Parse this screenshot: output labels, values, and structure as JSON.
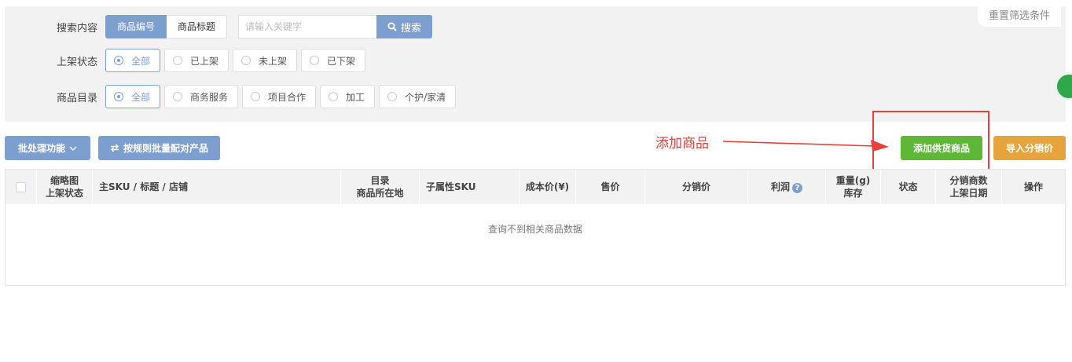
{
  "filters": {
    "reset_label": "重置筛选条件",
    "search": {
      "label": "搜索内容",
      "type_options": [
        "商品编号",
        "商品标题"
      ],
      "selected_type": "商品编号",
      "placeholder": "请输入关键字",
      "value": "",
      "button_label": "搜索"
    },
    "shelf_status": {
      "label": "上架状态",
      "options": [
        "全部",
        "已上架",
        "未上架",
        "已下架"
      ],
      "selected": "全部"
    },
    "catalog": {
      "label": "商品目录",
      "options": [
        "全部",
        "商务服务",
        "项目合作",
        "加工",
        "个护/家清"
      ],
      "selected": "全部"
    }
  },
  "toolbar": {
    "batch_label": "批处理功能",
    "match_label": "按规则批量配对产品",
    "add_label": "添加供货商品",
    "import_label": "导入分销价"
  },
  "annotation": {
    "text": "添加商品",
    "color": "#e8403a"
  },
  "table": {
    "columns": [
      {
        "line1": "缩略图",
        "line2": "上架状态"
      },
      {
        "line1": "主SKU / 标题 / 店铺",
        "line2": ""
      },
      {
        "line1": "目录",
        "line2": "商品所在地"
      },
      {
        "line1": "子属性SKU",
        "line2": ""
      },
      {
        "line1": "成本价(¥)",
        "line2": ""
      },
      {
        "line1": "售价",
        "line2": ""
      },
      {
        "line1": "分销价",
        "line2": ""
      },
      {
        "line1": "利润",
        "line2": ""
      },
      {
        "line1": "重量(g)",
        "line2": "库存"
      },
      {
        "line1": "状态",
        "line2": ""
      },
      {
        "line1": "分销商数",
        "line2": "上架日期"
      },
      {
        "line1": "操作",
        "line2": ""
      }
    ],
    "empty_message": "查询不到相关商品数据"
  },
  "colors": {
    "primary": "#7c9fd0",
    "success": "#5db836",
    "warning": "#e8a43c"
  }
}
